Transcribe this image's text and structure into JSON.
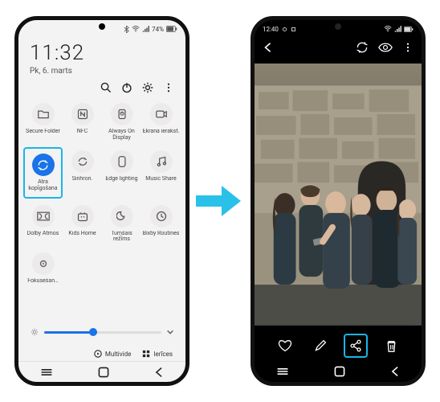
{
  "left_phone": {
    "statusbar": {
      "battery_text": "74%"
    },
    "time": "11:32",
    "date": "Pk, 6. marts",
    "qs_actions": {
      "search_icon": "search",
      "power_icon": "power",
      "settings_icon": "settings",
      "more_icon": "more"
    },
    "tiles": [
      {
        "icon": "folder",
        "label": "Secure Folder",
        "on": false
      },
      {
        "icon": "nfc",
        "label": "NFC",
        "on": false
      },
      {
        "icon": "aod",
        "label": "Always On Display",
        "on": false
      },
      {
        "icon": "record",
        "label": "Ekrāna ierakst.",
        "on": false
      },
      {
        "icon": "share",
        "label": "Ātrā kopīgošana",
        "on": true,
        "highlight": true
      },
      {
        "icon": "sync",
        "label": "Sinhron.",
        "on": false
      },
      {
        "icon": "edge",
        "label": "Edge lighting",
        "on": false
      },
      {
        "icon": "music",
        "label": "Music Share",
        "on": false
      },
      {
        "icon": "dolby",
        "label": "Dolby Atmos",
        "on": false
      },
      {
        "icon": "kids",
        "label": "Kids Home",
        "on": false
      },
      {
        "icon": "dark",
        "label": "Tumšais režīms",
        "on": false
      },
      {
        "icon": "bixby",
        "label": "Bixby Routines",
        "on": false
      }
    ],
    "partial_tile": {
      "icon": "focus",
      "label": "Fokusēšan…"
    },
    "brightness_pct": 42,
    "bottom": {
      "media_label": "Multivide",
      "devices_label": "Ierīces"
    }
  },
  "right_phone": {
    "status_time": "12:40",
    "topbar": {
      "back_icon": "back",
      "auto_icon": "auto",
      "eye_icon": "eye",
      "more_icon": "more"
    },
    "actions": {
      "favorite_icon": "heart",
      "edit_icon": "pencil",
      "share_icon": "share",
      "delete_icon": "trash"
    },
    "share_highlight": true
  },
  "colors": {
    "highlight": "#19b5e6",
    "accent": "#1a73e8"
  }
}
